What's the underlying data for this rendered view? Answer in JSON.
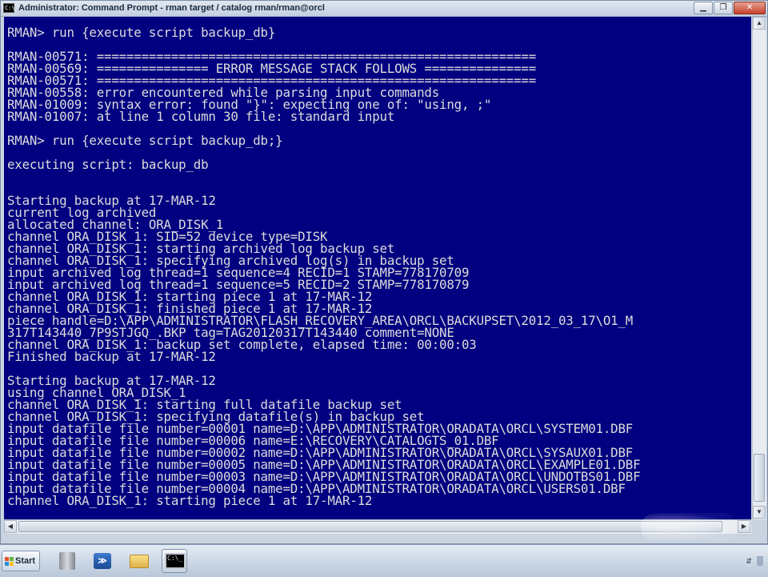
{
  "window": {
    "title": "Administrator: Command Prompt - rman  target / catalog rman/rman@orcl",
    "icon_label": "C:\\",
    "controls": {
      "minimize_icon": "minimize-icon",
      "restore_icon": "restore-icon",
      "close_icon": "close-icon"
    }
  },
  "console": {
    "lines": [
      "RMAN> run {execute script backup_db}",
      "",
      "RMAN-00571: ===========================================================",
      "RMAN-00569: =============== ERROR MESSAGE STACK FOLLOWS ===============",
      "RMAN-00571: ===========================================================",
      "RMAN-00558: error encountered while parsing input commands",
      "RMAN-01009: syntax error: found \"}\": expecting one of: \"using, ;\"",
      "RMAN-01007: at line 1 column 30 file: standard input",
      "",
      "RMAN> run {execute script backup_db;}",
      "",
      "executing script: backup_db",
      "",
      "",
      "Starting backup at 17-MAR-12",
      "current log archived",
      "allocated channel: ORA_DISK_1",
      "channel ORA_DISK_1: SID=52 device type=DISK",
      "channel ORA_DISK_1: starting archived log backup set",
      "channel ORA_DISK_1: specifying archived log(s) in backup set",
      "input archived log thread=1 sequence=4 RECID=1 STAMP=778170709",
      "input archived log thread=1 sequence=5 RECID=2 STAMP=778170879",
      "channel ORA_DISK_1: starting piece 1 at 17-MAR-12",
      "channel ORA_DISK_1: finished piece 1 at 17-MAR-12",
      "piece handle=D:\\APP\\ADMINISTRATOR\\FLASH_RECOVERY_AREA\\ORCL\\BACKUPSET\\2012_03_17\\O1_M",
      "317T143440_7P9STJGQ_.BKP tag=TAG20120317T143440 comment=NONE",
      "channel ORA_DISK_1: backup set complete, elapsed time: 00:00:03",
      "Finished backup at 17-MAR-12",
      "",
      "Starting backup at 17-MAR-12",
      "using channel ORA_DISK_1",
      "channel ORA_DISK_1: starting full datafile backup set",
      "channel ORA_DISK_1: specifying datafile(s) in backup set",
      "input datafile file number=00001 name=D:\\APP\\ADMINISTRATOR\\ORADATA\\ORCL\\SYSTEM01.DBF",
      "input datafile file number=00006 name=E:\\RECOVERY\\CATALOGTS_01.DBF",
      "input datafile file number=00002 name=D:\\APP\\ADMINISTRATOR\\ORADATA\\ORCL\\SYSAUX01.DBF",
      "input datafile file number=00005 name=D:\\APP\\ADMINISTRATOR\\ORADATA\\ORCL\\EXAMPLE01.DBF",
      "input datafile file number=00003 name=D:\\APP\\ADMINISTRATOR\\ORADATA\\ORCL\\UNDOTBS01.DBF",
      "input datafile file number=00004 name=D:\\APP\\ADMINISTRATOR\\ORADATA\\ORCL\\USERS01.DBF",
      "channel ORA_DISK_1: starting piece 1 at 17-MAR-12"
    ],
    "background_color": "#000080",
    "text_color": "#dcdcdc"
  },
  "taskbar": {
    "start_label": "Start",
    "icons": [
      "server-manager-icon",
      "powershell-icon",
      "explorer-folder-icon",
      "command-prompt-icon"
    ],
    "powershell_glyph": "≫",
    "cmd_glyph": "C:\\_"
  }
}
